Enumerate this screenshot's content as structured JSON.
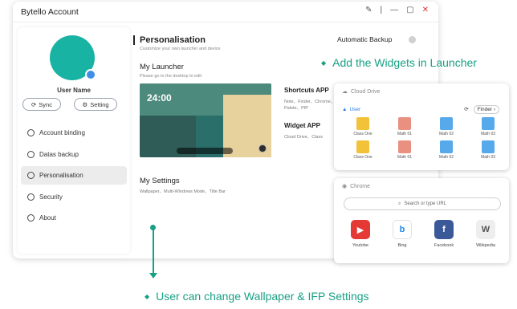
{
  "window": {
    "title": "Bytello Account",
    "controls": [
      "pin-icon",
      "divider",
      "minimize-icon",
      "maximize-icon",
      "close-icon"
    ]
  },
  "sidebar": {
    "user_name": "User Name",
    "sync_label": "Sync",
    "setting_label": "Setting",
    "items": [
      {
        "label": "Account binding",
        "icon": "link-icon"
      },
      {
        "label": "Datas backup",
        "icon": "cloud-upload-icon"
      },
      {
        "label": "Personalisation",
        "icon": "palette-icon",
        "active": true
      },
      {
        "label": "Security",
        "icon": "shield-icon"
      },
      {
        "label": "About",
        "icon": "info-icon"
      }
    ]
  },
  "main": {
    "title": "Personalisation",
    "subtitle": "Customize your own launcher and device",
    "auto_backup": "Automatic Backup",
    "launcher": {
      "title": "My Launcher",
      "subtitle": "Please go to the desktop to edit",
      "preview_clock": "24:00",
      "shortcuts": {
        "title": "Shortcuts APP",
        "items": "Note、Finder、Chrome、Palete、PIP"
      },
      "widget": {
        "title": "Widget APP",
        "items": "Cloud Drive、Class"
      }
    },
    "settings": {
      "title": "My Settings",
      "items": "Wallpaper、Multi-Windows Mode、Title Bar"
    }
  },
  "annotations": {
    "widgets": "Add the Widgets in Launcher",
    "wallpaper": "User can change Wallpaper & IFP Settings",
    "accent_color": "#18a085"
  },
  "cloud_drive": {
    "title": "Cloud Drive",
    "tab": "User",
    "finder": "Finder",
    "files": [
      {
        "name": "Class One",
        "type": "folder"
      },
      {
        "name": "Math 01",
        "type": "pdf"
      },
      {
        "name": "Math 02",
        "type": "doc"
      },
      {
        "name": "Math 03",
        "type": "doc"
      },
      {
        "name": "Class One",
        "type": "folder"
      },
      {
        "name": "Math 01",
        "type": "pdf"
      },
      {
        "name": "Math 02",
        "type": "doc"
      },
      {
        "name": "Math 03",
        "type": "doc"
      }
    ]
  },
  "chrome": {
    "title": "Chrome",
    "search_placeholder": "Search or type URL",
    "apps": [
      {
        "name": "Youtobe",
        "glyph": "▶",
        "color": "#e53935"
      },
      {
        "name": "Bing",
        "glyph": "b",
        "color": "#1e88e5"
      },
      {
        "name": "Facebook",
        "glyph": "f",
        "color": "#3b5998"
      },
      {
        "name": "Wikipedia",
        "glyph": "W",
        "color": "#9e9e9e"
      }
    ]
  }
}
